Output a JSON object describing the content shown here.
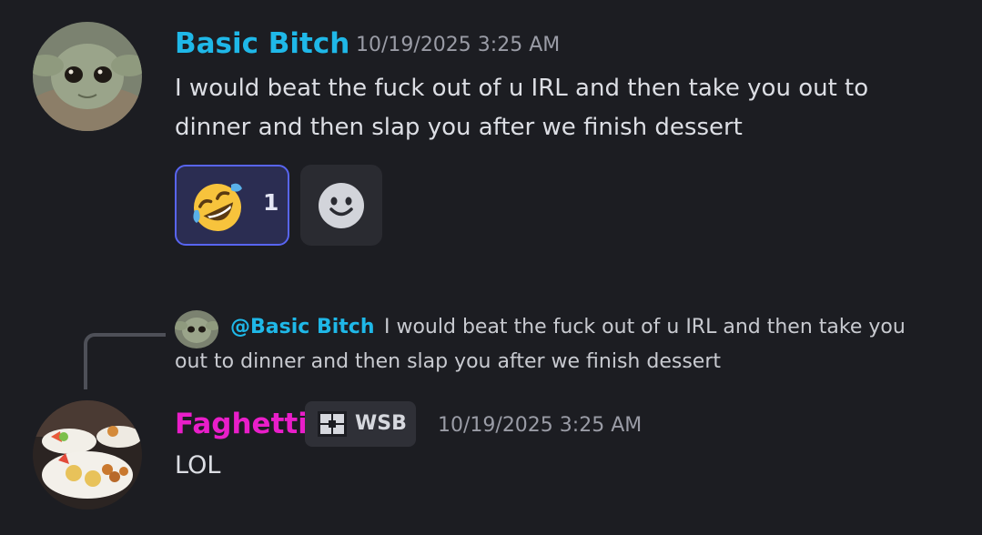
{
  "messages": [
    {
      "author": "Basic Bitch",
      "author_color": "#1fb8e8",
      "timestamp": "10/19/2025 3:25 AM",
      "text": "I would beat the fuck out of u IRL and then take you out to dinner and then slap you after we finish dessert",
      "reactions": [
        {
          "emoji": "rolling-on-floor-laughing",
          "count": "1",
          "active": true
        }
      ]
    },
    {
      "author": "Faghetti",
      "author_color": "#e91ec9",
      "role_tag": "WSB",
      "timestamp": "10/19/2025 3:25 AM",
      "text": "LOL",
      "reply_to": {
        "mention": "@Basic Bitch",
        "text": "I would beat the fuck out of u IRL and then take you out to dinner and then slap you after we finish dessert"
      }
    }
  ],
  "colors": {
    "background": "#1c1d22",
    "reaction_active_border": "#5865f2",
    "reaction_active_bg": "#2b2d52",
    "timestamp": "#9a9ca6"
  },
  "icons": {
    "add_reaction": "smiley-face-icon",
    "role_icon": "puzzle-icon"
  }
}
